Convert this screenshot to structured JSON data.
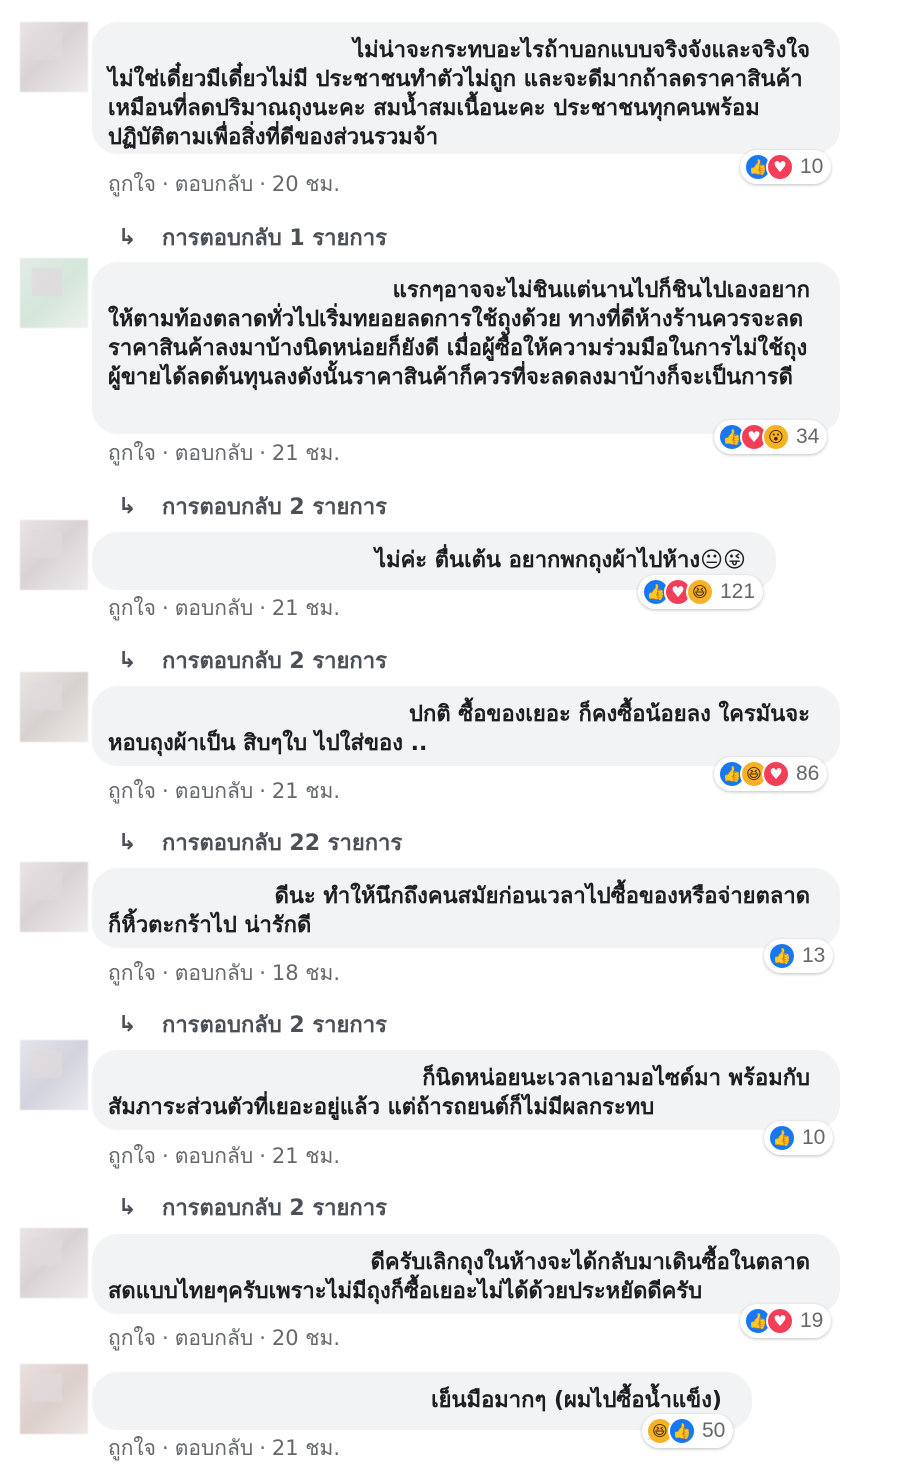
{
  "comments": [
    {
      "first_line": "ไม่น่าจะกระทบอะไรถ้าบอกแบบจริงจังและจริงใจ",
      "rest": "ไม่ใช่เดี๋ยวมีเดี๋ยวไม่มี ประชาชนทำตัวไม่ถูก และจะดีมากถ้าลดราคาสินค้าเหมือนที่ลดปริมาณถุงนะคะ สมน้ำสมเนื้อนะคะ ประชาชนทุกคนพร้อมปฏิบัติตามเพื่อสิ่งที่ดีของส่วนรวมจ้า",
      "reaction_count": "10",
      "like_label": "ถูกใจ",
      "reply_label": "ตอบกลับ",
      "time": "20 ชม.",
      "replies_text": "การตอบกลับ 1 รายการ"
    },
    {
      "first_line": "แรกๆอาจจะไม่ชินแต่นานไปก็ชินไปเองอยาก",
      "rest": "ให้ตามท้องตลาดทั่วไปเริ่มทยอยลดการใช้ถุงด้วย ทางที่ดีห้างร้านควรจะลดราคาสินค้าลงมาบ้างนิดหน่อยก็ยังดี เมื่อผู้ซื้อให้ความร่วมมือในการไม่ใช้ถุงผู้ขายได้ลดต้นทุนลงดังนั้นราคาสินค้าก็ควรที่จะลดลงมาบ้างก็จะเป็นการดี",
      "reaction_count": "34",
      "like_label": "ถูกใจ",
      "reply_label": "ตอบกลับ",
      "time": "21 ชม.",
      "replies_text": "การตอบกลับ 2 รายการ"
    },
    {
      "first_line": "ไม่ค่ะ ตื่นเต้น อยากพกถุงผ้าไปห้าง😐😜",
      "rest": "",
      "reaction_count": "121",
      "like_label": "ถูกใจ",
      "reply_label": "ตอบกลับ",
      "time": "21 ชม.",
      "replies_text": "การตอบกลับ 2 รายการ"
    },
    {
      "first_line": "ปกติ ซื้อของเยอะ ก็คงซื้อน้อยลง ใครมันจะ",
      "rest": "หอบถุงผ้าเป็น สิบๆใบ ไปใส่ของ ..",
      "reaction_count": "86",
      "like_label": "ถูกใจ",
      "reply_label": "ตอบกลับ",
      "time": "21 ชม.",
      "replies_text": "การตอบกลับ 22 รายการ"
    },
    {
      "first_line": "ดีนะ ทำให้นึกถึงคนสมัยก่อนเวลาไปซื้อของหรือจ่ายตลาด",
      "rest": "ก็หิ้วตะกร้าไป น่ารักดี",
      "reaction_count": "13",
      "like_label": "ถูกใจ",
      "reply_label": "ตอบกลับ",
      "time": "18 ชม.",
      "replies_text": "การตอบกลับ 2 รายการ"
    },
    {
      "first_line": "ก็นิดหน่อยนะเวลาเอามอไซด์มา พร้อมกับ",
      "rest": "สัมภาระส่วนตัวที่เยอะอยู่แล้ว แต่ถ้ารถยนต์ก็ไม่มีผลกระทบ",
      "reaction_count": "10",
      "like_label": "ถูกใจ",
      "reply_label": "ตอบกลับ",
      "time": "21 ชม.",
      "replies_text": "การตอบกลับ 2 รายการ"
    },
    {
      "first_line": "ดีครับเลิกถุงในห้างจะได้กลับมาเดินซื้อในตลาด",
      "rest": "สดแบบไทยๆครับเพราะไม่มีถุงก็ซื้อเยอะไม่ได้ด้วยประหยัดดีครับ",
      "reaction_count": "19",
      "like_label": "ถูกใจ",
      "reply_label": "ตอบกลับ",
      "time": "20 ชม.",
      "replies_text": ""
    },
    {
      "first_line": "เย็นมือมากๆ (ผมไปซื้อน้ำแข็ง)",
      "rest": "",
      "reaction_count": "50",
      "like_label": "ถูกใจ",
      "reply_label": "ตอบกลับ",
      "time": "21 ชม.",
      "replies_text": ""
    }
  ],
  "icons": {
    "like": "like-icon",
    "love": "love-icon",
    "wow": "wow-icon",
    "haha": "haha-icon",
    "reply_arrow": "reply-arrow-icon"
  },
  "colors": {
    "like": "#1877f2",
    "love": "#f33e58",
    "wow": "#f7b125",
    "bubble": "#f2f3f5",
    "meta": "#65676b"
  }
}
